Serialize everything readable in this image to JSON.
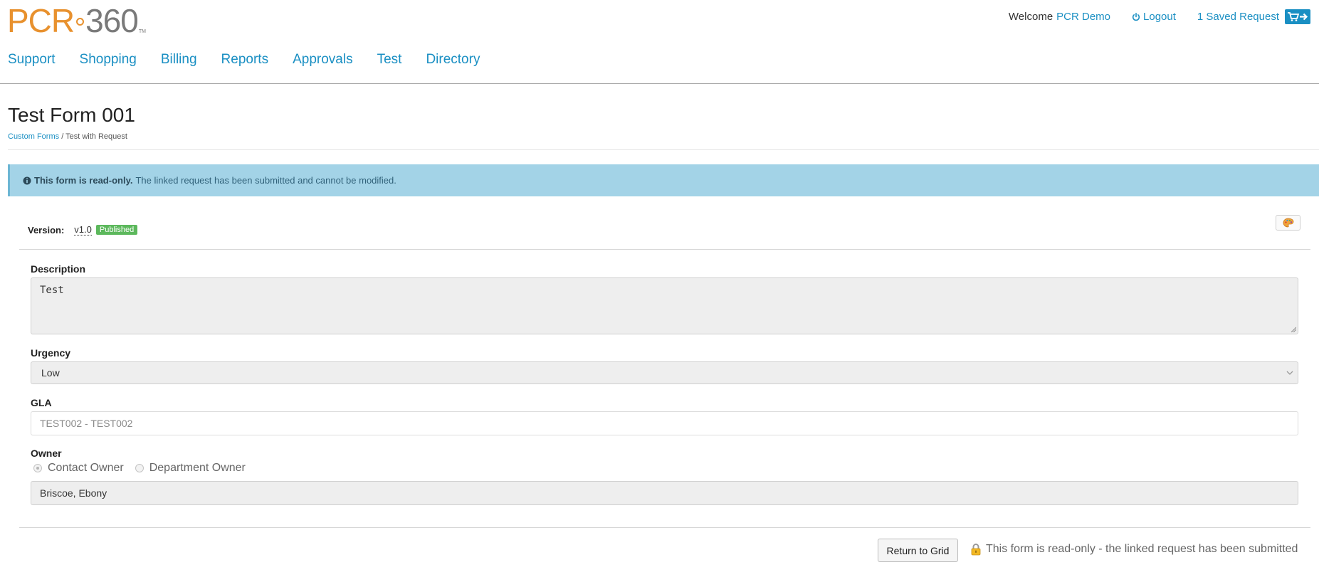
{
  "header": {
    "logo_text": "PCR",
    "logo_number": "360",
    "logo_tm": "TM",
    "welcome": "Welcome",
    "user_name": "PCR Demo",
    "logout": "Logout",
    "saved_request": "1 Saved Request",
    "icons": {
      "logout": "power-icon",
      "cart": "cart-icon",
      "arrow": "arrow-right-icon"
    }
  },
  "nav": {
    "items": [
      "Support",
      "Shopping",
      "Billing",
      "Reports",
      "Approvals",
      "Test",
      "Directory"
    ]
  },
  "page": {
    "title": "Test Form 001",
    "breadcrumb_link": "Custom Forms",
    "breadcrumb_sep": "/",
    "breadcrumb_current": "Test with Request"
  },
  "alert": {
    "icon": "info-icon",
    "strong": "This form is read-only.",
    "text": "The linked request has been submitted and cannot be modified."
  },
  "version": {
    "label": "Version:",
    "value": "v1.0",
    "status": "Published",
    "palette_icon": "palette-icon"
  },
  "form": {
    "description_label": "Description",
    "description_value": "Test",
    "urgency_label": "Urgency",
    "urgency_value": "Low",
    "gla_label": "GLA",
    "gla_placeholder": "TEST002 - TEST002",
    "owner_label": "Owner",
    "owner_option_1": "Contact Owner",
    "owner_option_2": "Department Owner",
    "owner_selected": "Contact Owner",
    "owner_value": "Briscoe, Ebony"
  },
  "footer": {
    "return_button": "Return to Grid",
    "readonly_note": "This form is read-only - the linked request has been submitted",
    "lock_icon": "lock-icon"
  },
  "colors": {
    "brand_orange": "#e8912e",
    "link_blue": "#1a8fc3",
    "alert_bg": "#a3d3e7",
    "badge_green": "#5cb85c"
  }
}
